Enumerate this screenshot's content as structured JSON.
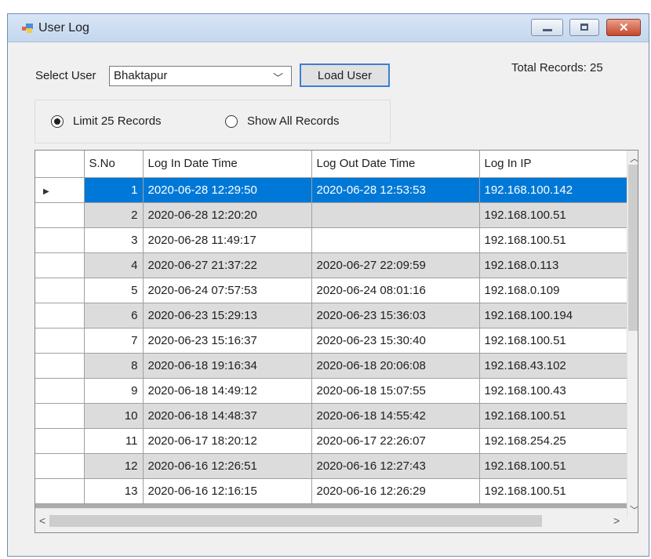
{
  "window": {
    "title": "User Log"
  },
  "controls": {
    "select_user_label": "Select User",
    "selected_user": "Bhaktapur",
    "load_button": "Load User",
    "total_records": "Total Records: 25"
  },
  "options": {
    "limit_label": "Limit 25 Records",
    "show_all_label": "Show All Records",
    "selected": "limit"
  },
  "grid": {
    "columns": [
      "S.No",
      "Log In Date Time",
      "Log Out Date Time",
      "Log In IP"
    ],
    "rows": [
      [
        "1",
        "2020-06-28 12:29:50",
        "2020-06-28 12:53:53",
        "192.168.100.142"
      ],
      [
        "2",
        "2020-06-28 12:20:20",
        "",
        "192.168.100.51"
      ],
      [
        "3",
        "2020-06-28 11:49:17",
        "",
        "192.168.100.51"
      ],
      [
        "4",
        "2020-06-27 21:37:22",
        "2020-06-27 22:09:59",
        "192.168.0.113"
      ],
      [
        "5",
        "2020-06-24 07:57:53",
        "2020-06-24 08:01:16",
        "192.168.0.109"
      ],
      [
        "6",
        "2020-06-23 15:29:13",
        "2020-06-23 15:36:03",
        "192.168.100.194"
      ],
      [
        "7",
        "2020-06-23 15:16:37",
        "2020-06-23 15:30:40",
        "192.168.100.51"
      ],
      [
        "8",
        "2020-06-18 19:16:34",
        "2020-06-18 20:06:08",
        "192.168.43.102"
      ],
      [
        "9",
        "2020-06-18 14:49:12",
        "2020-06-18 15:07:55",
        "192.168.100.43"
      ],
      [
        "10",
        "2020-06-18 14:48:37",
        "2020-06-18 14:55:42",
        "192.168.100.51"
      ],
      [
        "11",
        "2020-06-17 18:20:12",
        "2020-06-17 22:26:07",
        "192.168.254.25"
      ],
      [
        "12",
        "2020-06-16 12:26:51",
        "2020-06-16 12:27:43",
        "192.168.100.51"
      ],
      [
        "13",
        "2020-06-16 12:16:15",
        "2020-06-16 12:26:29",
        "192.168.100.51"
      ]
    ],
    "selected_row": 0
  },
  "colors": {
    "selection": "#0078d7",
    "alt_row": "#dcdcdc",
    "button_border": "#3c7fd1"
  },
  "icons": {
    "app": "user-log-app-icon",
    "combo": "chevron-down-icon",
    "row_marker": "current-row-arrow-icon"
  }
}
